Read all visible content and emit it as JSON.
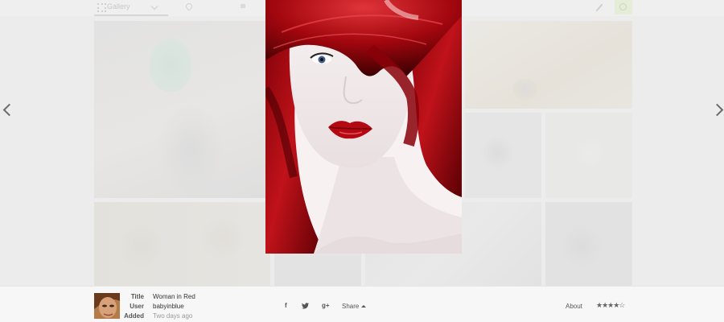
{
  "background": {
    "toolbar": {
      "gallery_tab": "Gallery"
    }
  },
  "photo": {
    "title": "Woman in Red",
    "user": "babyinblue",
    "added": "Two days ago"
  },
  "meta": {
    "title_label": "Title",
    "user_label": "User",
    "added_label": "Added"
  },
  "social": {
    "facebook": "f",
    "twitter_icon": "twitter-bird",
    "googleplus": "g+",
    "share_label": "Share"
  },
  "about_label": "About",
  "rating": {
    "value": 4,
    "max": 5,
    "display": "★★★★☆"
  },
  "colors": {
    "accent_red": "#b01016",
    "bar_bg": "#f7f7f7"
  }
}
